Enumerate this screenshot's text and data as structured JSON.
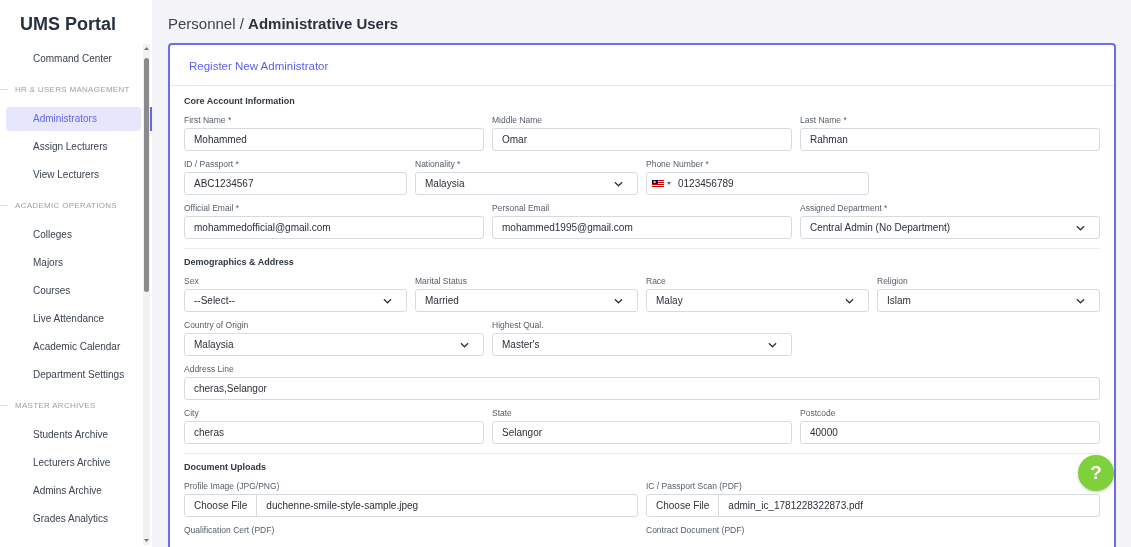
{
  "sidebar": {
    "logo": "UMS Portal",
    "sections": [
      {
        "items": [
          {
            "label": "Command Center",
            "selected": false
          }
        ]
      },
      {
        "heading": "HR & USERS MANAGEMENT",
        "items": [
          {
            "label": "Administrators",
            "selected": true
          },
          {
            "label": "Assign Lecturers",
            "selected": false
          },
          {
            "label": "View Lecturers",
            "selected": false
          }
        ]
      },
      {
        "heading": "ACADEMIC OPERATIONS",
        "items": [
          {
            "label": "Colleges",
            "selected": false
          },
          {
            "label": "Majors",
            "selected": false
          },
          {
            "label": "Courses",
            "selected": false
          },
          {
            "label": "Live Attendance",
            "selected": false
          },
          {
            "label": "Academic Calendar",
            "selected": false
          },
          {
            "label": "Department Settings",
            "selected": false
          }
        ]
      },
      {
        "heading": "MASTER ARCHIVES",
        "items": [
          {
            "label": "Students Archive",
            "selected": false
          },
          {
            "label": "Lecturers Archive",
            "selected": false
          },
          {
            "label": "Admins Archive",
            "selected": false
          },
          {
            "label": "Grades Analytics",
            "selected": false
          }
        ]
      }
    ]
  },
  "breadcrumb": {
    "parent": "Personnel",
    "separator": "/",
    "current": "Administrative Users"
  },
  "card": {
    "title": "Register New Administrator",
    "sections": [
      {
        "title": "Core Account Information",
        "rows": [
          [
            {
              "kind": "input",
              "label": "First Name *",
              "value": "Mohammed"
            },
            {
              "kind": "input",
              "label": "Middle Name",
              "value": "Omar"
            },
            {
              "kind": "input",
              "label": "Last Name *",
              "value": "Rahman"
            }
          ],
          [
            {
              "kind": "input",
              "label": "ID / Passport *",
              "value": "ABC1234567"
            },
            {
              "kind": "select",
              "label": "Nationality *",
              "value": "Malaysia"
            },
            {
              "kind": "phone",
              "label": "Phone Number *",
              "value": "0123456789"
            }
          ],
          [
            {
              "kind": "input",
              "label": "Official Email *",
              "value": "mohammedofficial@gmail.com"
            },
            {
              "kind": "input",
              "label": "Personal Email",
              "value": "mohammed1995@gmail.com"
            },
            {
              "kind": "select",
              "label": "Assigned Department *",
              "value": "Central Admin (No Department)"
            }
          ]
        ]
      },
      {
        "title": "Demographics & Address",
        "rows": [
          [
            {
              "kind": "select",
              "label": "Sex",
              "value": "--Select--"
            },
            {
              "kind": "select",
              "label": "Marital Status",
              "value": "Married"
            },
            {
              "kind": "select",
              "label": "Race",
              "value": "Malay"
            },
            {
              "kind": "select",
              "label": "Religion",
              "value": "Islam"
            }
          ],
          [
            {
              "kind": "select",
              "label": "Country of Origin",
              "value": "Malaysia"
            },
            {
              "kind": "select",
              "label": "Highest Qual.",
              "value": "Master's"
            }
          ],
          [
            {
              "kind": "input",
              "label": "Address Line",
              "value": "cheras,Selangor"
            }
          ],
          [
            {
              "kind": "input",
              "label": "City",
              "value": "cheras"
            },
            {
              "kind": "input",
              "label": "State",
              "value": "Selangor"
            },
            {
              "kind": "input",
              "label": "Postcode",
              "value": "40000"
            }
          ]
        ]
      },
      {
        "title": "Document Uploads",
        "rows": [
          [
            {
              "kind": "file",
              "label": "Profile Image (JPG/PNG)",
              "button": "Choose File",
              "value": "duchenne-smile-style-sample.jpeg"
            },
            {
              "kind": "file",
              "label": "IC / Passport Scan (PDF)",
              "button": "Choose File",
              "value": "admin_ic_1781228322873.pdf"
            }
          ],
          [
            {
              "kind": "label",
              "label": "Qualification Cert (PDF)"
            },
            {
              "kind": "label",
              "label": "Contract Document (PDF)"
            }
          ]
        ]
      }
    ]
  },
  "help_button": {
    "label": "?"
  }
}
